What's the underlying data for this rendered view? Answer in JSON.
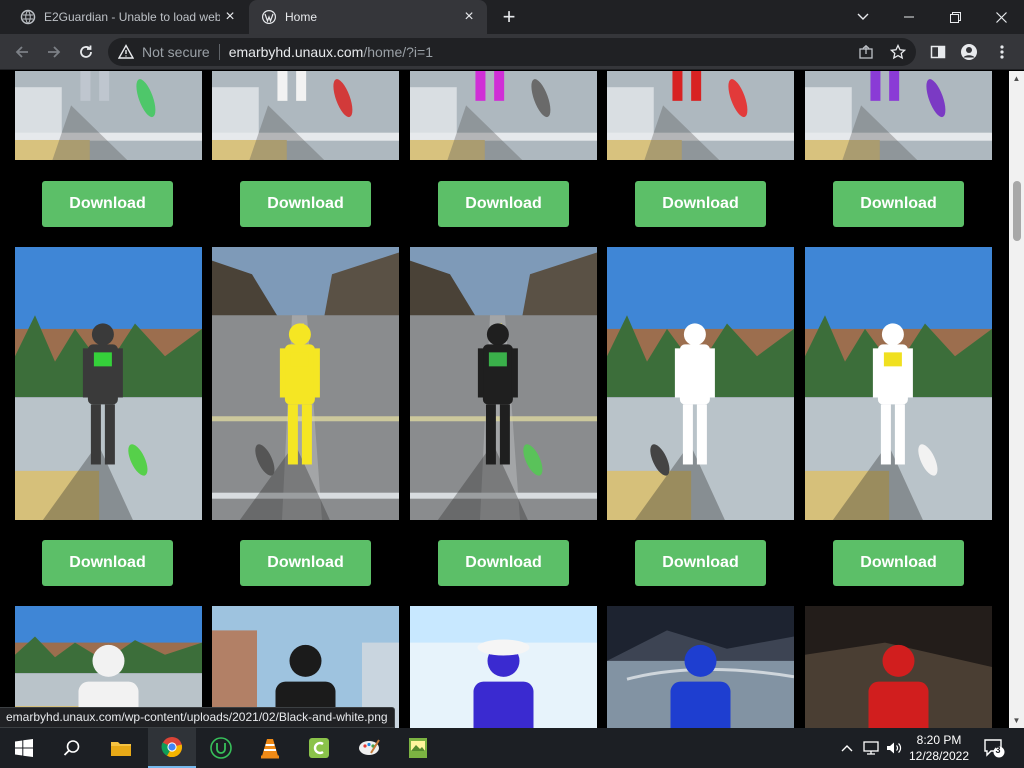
{
  "tabs": [
    {
      "title": "E2Guardian - Unable to load web",
      "active": false
    },
    {
      "title": "Home",
      "active": true
    }
  ],
  "address_bar": {
    "security_label": "Not secure",
    "url_host": "emarbyhd.unaux.com",
    "url_path": "/home/?i=1"
  },
  "gallery": {
    "button_label": "Download",
    "button_color": "#5cbf68",
    "rows": [
      {
        "items": [
          {
            "shirt": "#bfc6cf",
            "board": "#4ec76a",
            "scene": "road-top"
          },
          {
            "shirt": "#f2f2f2",
            "board": "#d23a3a",
            "scene": "road-top"
          },
          {
            "shirt": "#d02fd6",
            "board": "#6a6a6a",
            "scene": "road-top"
          },
          {
            "shirt": "#d82222",
            "board": "#e23a3a",
            "scene": "road-top"
          },
          {
            "shirt": "#8a3bd6",
            "board": "#7b3ac4",
            "scene": "road-top"
          }
        ]
      },
      {
        "items": [
          {
            "shirt": "#3a3a3a",
            "accent": "#35d13a",
            "board": "#56d04a",
            "scene": "desert"
          },
          {
            "shirt": "#f5e623",
            "accent": "#f5e623",
            "board": "#555555",
            "scene": "road"
          },
          {
            "shirt": "#1f1f1f",
            "accent": "#3ab04a",
            "board": "#5ac25a",
            "scene": "road"
          },
          {
            "shirt": "#ffffff",
            "accent": "#ffffff",
            "board": "#444444",
            "scene": "desert"
          },
          {
            "shirt": "#ffffff",
            "accent": "#f0e020",
            "board": "#f2f2f2",
            "scene": "desert"
          }
        ]
      },
      {
        "items": [
          {
            "shirt": "#f2f2f2",
            "scene": "desert"
          },
          {
            "shirt": "#1b1b1b",
            "scene": "city"
          },
          {
            "shirt": "#3a2ad0",
            "scene": "bright"
          },
          {
            "shirt": "#1e3ed0",
            "scene": "dark-road"
          },
          {
            "shirt": "#d11e1e",
            "scene": "dark"
          }
        ]
      }
    ]
  },
  "status_bubble": "emarbyhd.unaux.com/wp-content/uploads/2021/02/Black-and-white.png",
  "taskbar": {
    "time": "8:20 PM",
    "date": "12/28/2022",
    "notification_count": "3"
  }
}
